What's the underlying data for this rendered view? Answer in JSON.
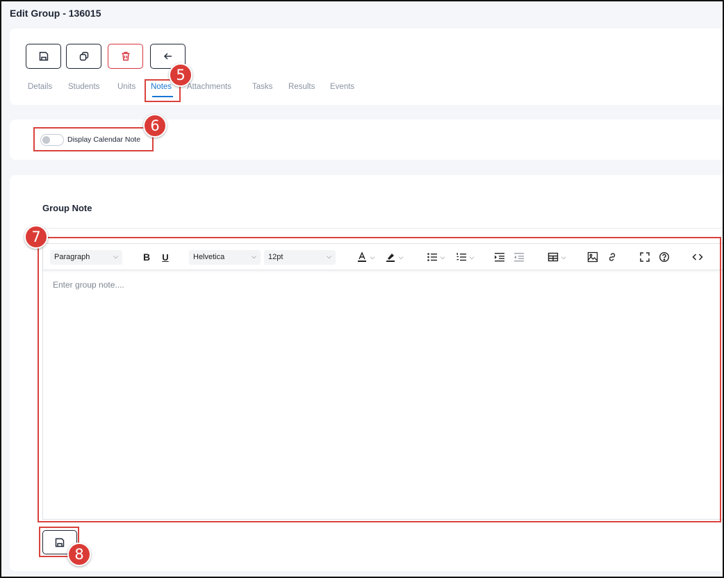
{
  "page": {
    "title": "Edit Group - 136015"
  },
  "actions": {
    "save": "save-icon",
    "copy": "copy-icon",
    "delete": "trash-icon",
    "back": "arrow-left-icon"
  },
  "tabs": [
    {
      "label": "Details"
    },
    {
      "label": "Students"
    },
    {
      "label": "Units"
    },
    {
      "label": "Notes",
      "active": true
    },
    {
      "label": "Attachments"
    },
    {
      "label": "Tasks"
    },
    {
      "label": "Results"
    },
    {
      "label": "Events"
    }
  ],
  "calendar_toggle": {
    "label": "Display Calendar Note",
    "on": false
  },
  "group_note": {
    "title": "Group Note",
    "placeholder": "Enter group note....",
    "toolbar": {
      "block_format": "Paragraph",
      "font_family": "Helvetica",
      "font_size": "12pt",
      "bold": "B",
      "underline": "U"
    }
  },
  "callouts": [
    "5",
    "6",
    "7",
    "8"
  ],
  "colors": {
    "accent": "#1976d2",
    "danger": "#d6353d",
    "callout": "#db3b36"
  }
}
